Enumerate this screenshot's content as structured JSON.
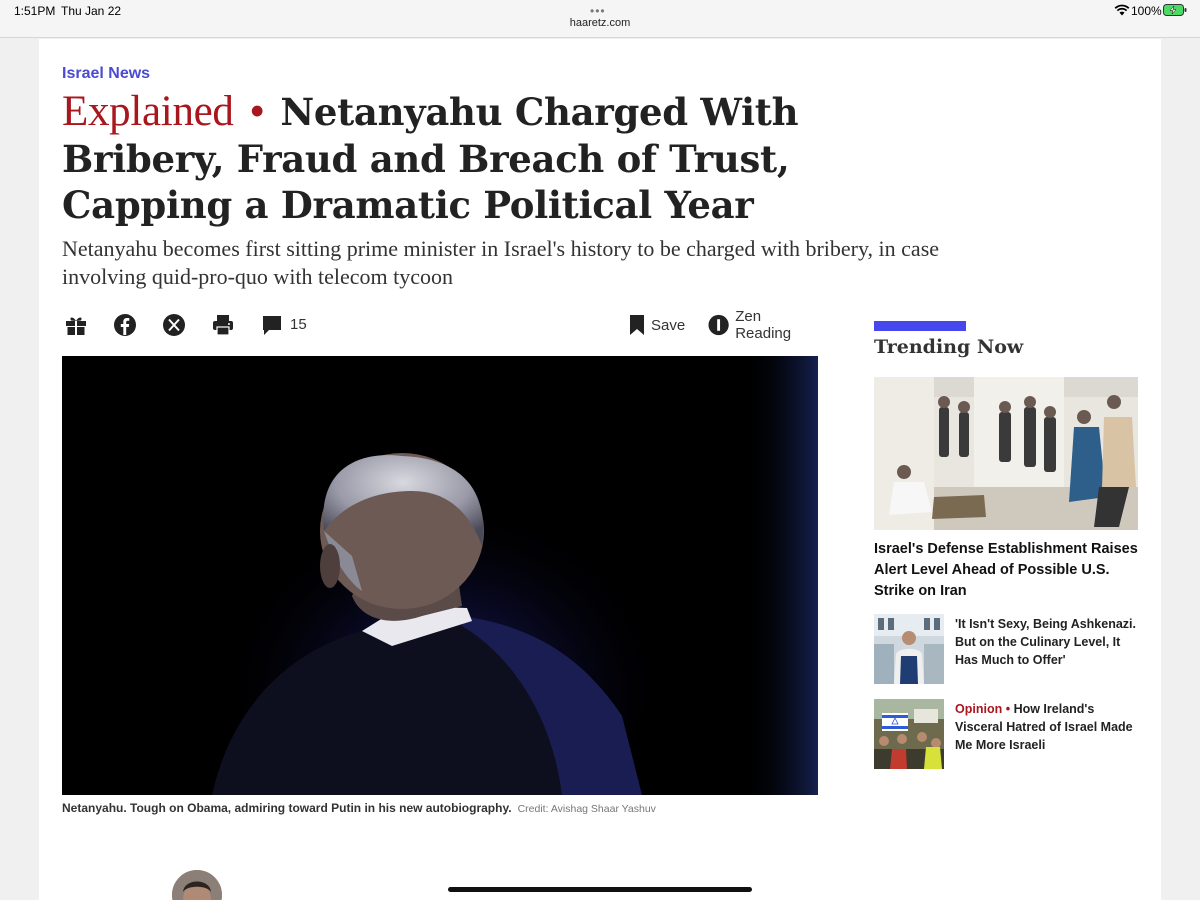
{
  "status_bar": {
    "time": "1:51PM",
    "date": "Thu Jan 22",
    "url": "haaretz.com",
    "battery": "100%"
  },
  "article": {
    "section": "Israel News",
    "kicker": "Explained",
    "separator": "•",
    "headline": "Netanyahu Charged With Bribery, Fraud and Breach of Trust, Capping a Dramatic Political Year",
    "subhead": "Netanyahu becomes first sitting prime minister in Israel's history to be charged with bribery, in case involving quid-pro-quo with telecom tycoon",
    "toolbar": {
      "icons": [
        "gift-icon",
        "facebook-icon",
        "x-icon",
        "print-icon",
        "comment-icon"
      ],
      "comment_count": "15",
      "save_label": "Save",
      "zen_label": "Zen Reading"
    },
    "image_caption": "Netanyahu. Tough on Obama, admiring toward Putin in his new autobiography.",
    "image_credit": "Credit: Avishag Shaar Yashuv"
  },
  "trending": {
    "title": "Trending Now",
    "main_item": {
      "title": "Israel's Defense Establishment Raises Alert Level Ahead of Possible U.S. Strike on Iran"
    },
    "items": [
      {
        "label": "",
        "title": "'It Isn't Sexy, Being Ashkenazi. But on the Culinary Level, It Has Much to Offer'"
      },
      {
        "label": "Opinion",
        "separator": "•",
        "title": "How Ireland's Visceral Hatred of Israel Made Me More Israeli"
      }
    ]
  },
  "colors": {
    "section_link": "#4a4ad4",
    "kicker_red": "#a8161e",
    "trending_accent": "#4747f0"
  }
}
